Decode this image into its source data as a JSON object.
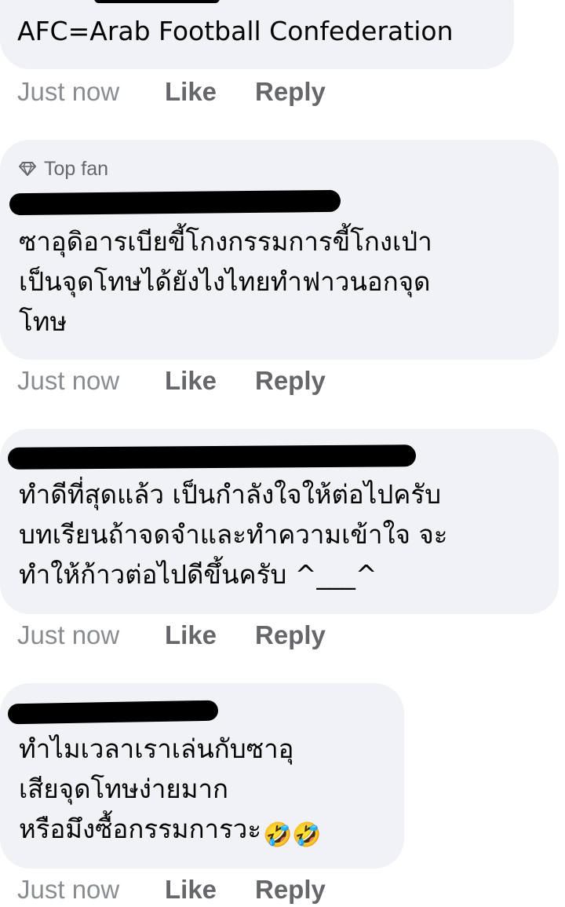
{
  "comments": [
    {
      "text": "AFC=Arab Football Confederation",
      "time": "Just now",
      "like": "Like",
      "reply": "Reply"
    },
    {
      "badge": "Top fan",
      "badge_icon": "diamond-icon",
      "text": "ซาอุดิอารเบียขี้โกงกรรมการขี้โกงเป่า\nเป็นจุดโทษได้ยังไงไทยทำฟาวนอกจุด\nโทษ",
      "time": "Just now",
      "like": "Like",
      "reply": "Reply"
    },
    {
      "text": "ทำดีที่สุดแล้ว เป็นกำลังใจให้ต่อไปครับ\nบทเรียนถ้าจดจำและทำความเข้าใจ จะ\nทำให้ก้าวต่อไปดีขึ้นครับ ^___^",
      "time": "Just now",
      "like": "Like",
      "reply": "Reply"
    },
    {
      "text": "ทำไมเวลาเราเล่นกับซาอุ\nเสียจุดโทษง่ายมาก\nหรือมึงซื้อกรรมการวะ",
      "emoji": "🤣🤣",
      "time": "Just now",
      "like": "Like",
      "reply": "Reply"
    }
  ],
  "colors": {
    "bubble": "#f0f2f5",
    "text": "#050505",
    "meta": "#65676b",
    "timestamp": "#8a8d91",
    "redaction": "#000000"
  }
}
